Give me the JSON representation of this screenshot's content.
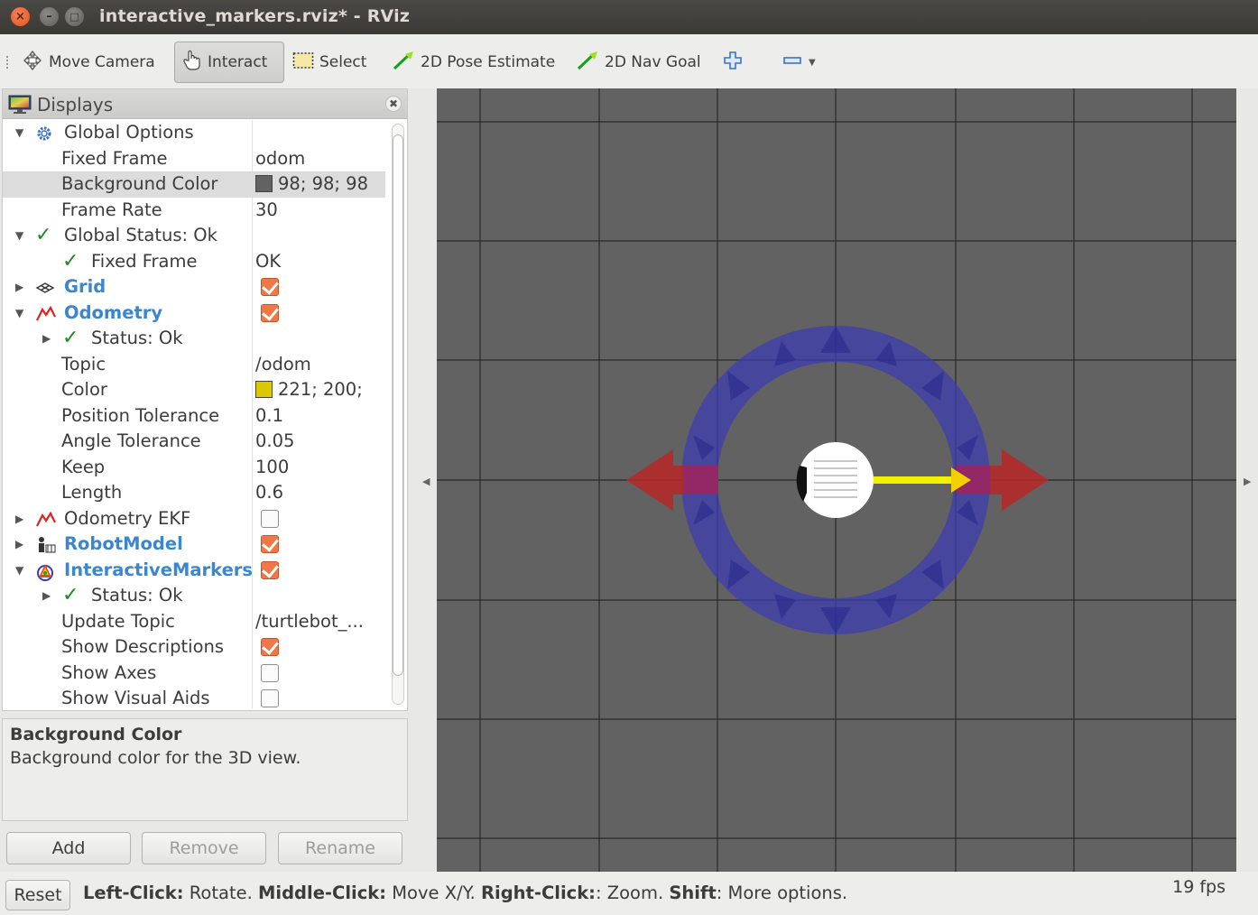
{
  "window": {
    "title": "interactive_markers.rviz* - RViz"
  },
  "toolbar": {
    "move_camera": "Move Camera",
    "interact": "Interact",
    "select": "Select",
    "pose_estimate": "2D Pose Estimate",
    "nav_goal": "2D Nav Goal"
  },
  "displays": {
    "title": "Displays",
    "rows": [
      {
        "name": "Global Options",
        "value": ""
      },
      {
        "name": "Fixed Frame",
        "value": "odom"
      },
      {
        "name": "Background Color",
        "value": "98; 98; 98",
        "swatch": "#626262"
      },
      {
        "name": "Frame Rate",
        "value": "30"
      },
      {
        "name": "Global Status: Ok",
        "value": ""
      },
      {
        "name": "Fixed Frame",
        "value": "OK"
      },
      {
        "name": "Grid",
        "checked": true
      },
      {
        "name": "Odometry",
        "checked": true
      },
      {
        "name": "Status: Ok",
        "value": ""
      },
      {
        "name": "Topic",
        "value": "/odom"
      },
      {
        "name": "Color",
        "value": "221; 200;",
        "swatch": "#ddc800"
      },
      {
        "name": "Position Tolerance",
        "value": "0.1"
      },
      {
        "name": "Angle Tolerance",
        "value": "0.05"
      },
      {
        "name": "Keep",
        "value": "100"
      },
      {
        "name": "Length",
        "value": "0.6"
      },
      {
        "name": "Odometry EKF",
        "checked": false
      },
      {
        "name": "RobotModel",
        "checked": true
      },
      {
        "name": "InteractiveMarkers",
        "checked": true
      },
      {
        "name": "Status: Ok",
        "value": ""
      },
      {
        "name": "Update Topic",
        "value": "/turtlebot_..."
      },
      {
        "name": "Show Descriptions",
        "checked": true
      },
      {
        "name": "Show Axes",
        "checked": false
      },
      {
        "name": "Show Visual Aids",
        "checked": false
      }
    ]
  },
  "description": {
    "title": "Background Color",
    "text": "Background color for the 3D view."
  },
  "buttons": {
    "add": "Add",
    "remove": "Remove",
    "rename": "Rename"
  },
  "statusbar": {
    "reset": "Reset",
    "k1": "Left-Click:",
    "v1": " Rotate. ",
    "k2": "Middle-Click:",
    "v2": " Move X/Y. ",
    "k3": "Right-Click:",
    "v3": ": Zoom. ",
    "k4": "Shift",
    "v4": ": More options.",
    "fps": "19 fps"
  },
  "colors": {
    "background": "#626262",
    "accent": "#3a86cf",
    "check": "#f07848",
    "ring": "#3c3cb4",
    "arrow_red": "#b42828",
    "odometry": "#ddc800"
  }
}
